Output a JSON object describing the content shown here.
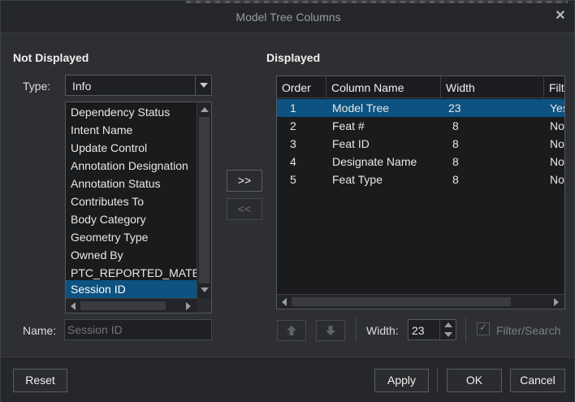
{
  "dialog": {
    "title": "Model Tree Columns",
    "close_glyph": "✕"
  },
  "not_displayed": {
    "heading": "Not Displayed",
    "type_label": "Type:",
    "type_value": "Info",
    "items": [
      {
        "label": "Dependency Status",
        "selected": false
      },
      {
        "label": "Intent Name",
        "selected": false
      },
      {
        "label": "Update Control",
        "selected": false
      },
      {
        "label": "Annotation Designation",
        "selected": false
      },
      {
        "label": "Annotation Status",
        "selected": false
      },
      {
        "label": "Contributes To",
        "selected": false
      },
      {
        "label": "Body Category",
        "selected": false
      },
      {
        "label": "Geometry Type",
        "selected": false
      },
      {
        "label": "Owned By",
        "selected": false
      },
      {
        "label": "PTC_REPORTED_MATERIAL",
        "selected": false
      },
      {
        "label": "Session ID",
        "selected": true
      }
    ],
    "name_label": "Name:",
    "name_placeholder": "Session ID"
  },
  "transfer": {
    "add_label": ">>",
    "remove_label": "<<"
  },
  "displayed": {
    "heading": "Displayed",
    "columns": [
      "Order",
      "Column Name",
      "Width",
      "Filter/Search"
    ],
    "rows": [
      {
        "order": "1",
        "name": "Model Tree",
        "width": "23",
        "filter": "Yes",
        "selected": true
      },
      {
        "order": "2",
        "name": "Feat #",
        "width": "8",
        "filter": "No",
        "selected": false
      },
      {
        "order": "3",
        "name": "Feat ID",
        "width": "8",
        "filter": "No",
        "selected": false
      },
      {
        "order": "4",
        "name": "Designate Name",
        "width": "8",
        "filter": "No",
        "selected": false
      },
      {
        "order": "5",
        "name": "Feat Type",
        "width": "8",
        "filter": "No",
        "selected": false
      }
    ],
    "width_label": "Width:",
    "width_value": "23",
    "filter_search_label": "Filter/Search",
    "filter_search_checked": true
  },
  "footer": {
    "reset": "Reset",
    "apply": "Apply",
    "ok": "OK",
    "cancel": "Cancel"
  },
  "colors": {
    "selection": "#0d5280",
    "background": "#2d2f32",
    "list_background": "#1a1b1d"
  },
  "icons": [
    "close-icon",
    "dropdown-chevron-icon",
    "move-up-icon",
    "move-down-icon",
    "spin-up-icon",
    "spin-down-icon",
    "checkbox-icon"
  ]
}
